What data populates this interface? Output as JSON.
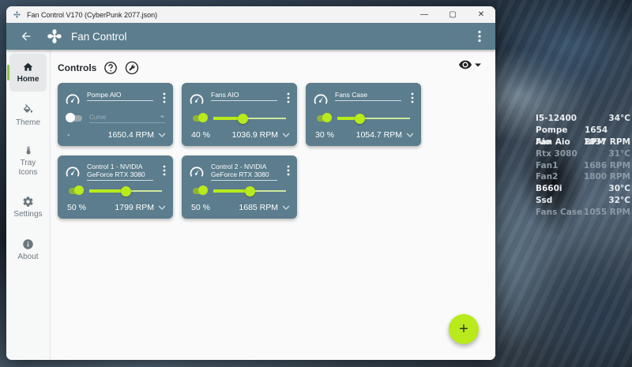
{
  "window": {
    "title": "Fan Control V170 (CyberPunk 2077.json)",
    "min_glyph": "—",
    "max_glyph": "▢",
    "close_glyph": "✕"
  },
  "appbar": {
    "title": "Fan Control"
  },
  "nav": [
    {
      "id": "home",
      "label": "Home",
      "icon": "home-icon",
      "active": true
    },
    {
      "id": "theme",
      "label": "Theme",
      "icon": "paint-bucket-icon",
      "active": false
    },
    {
      "id": "tray",
      "label": "Tray Icons",
      "icon": "thermometer-icon",
      "active": false
    },
    {
      "id": "settings",
      "label": "Settings",
      "icon": "gear-icon",
      "active": false
    },
    {
      "id": "about",
      "label": "About",
      "icon": "info-icon",
      "active": false
    }
  ],
  "controls": {
    "title": "Controls",
    "cards": [
      {
        "name": "Pompe AIO",
        "enabled": false,
        "mode": "select",
        "curve_placeholder": "Curve",
        "percent": "-",
        "rpm": "1650.4 RPM"
      },
      {
        "name": "Fans AIO",
        "enabled": true,
        "mode": "slider",
        "level": 0.4,
        "percent": "40 %",
        "rpm": "1036.9 RPM"
      },
      {
        "name": "Fans Case",
        "enabled": true,
        "mode": "slider",
        "level": 0.3,
        "percent": "30 %",
        "rpm": "1054.7 RPM"
      },
      {
        "name": "Control 1 - NVIDIA GeForce RTX 3080",
        "enabled": true,
        "mode": "slider",
        "level": 0.5,
        "percent": "50 %",
        "rpm": "1799 RPM"
      },
      {
        "name": "Control 2 - NVIDIA GeForce RTX 3080",
        "enabled": true,
        "mode": "slider",
        "level": 0.5,
        "percent": "50 %",
        "rpm": "1685 RPM"
      }
    ]
  },
  "fab": {
    "label": "+"
  },
  "desktop_sensors": [
    {
      "label": "I5-12400",
      "value": "34°C",
      "dim": false
    },
    {
      "label": "Pompe Aio",
      "value": "1654 RPM",
      "dim": false
    },
    {
      "label": "Fan Aio",
      "value": "1037 RPM",
      "dim": false
    },
    {
      "label": "Rtx 3080",
      "value": "31°C",
      "dim": true
    },
    {
      "label": "Fan1",
      "value": "1686 RPM",
      "dim": true
    },
    {
      "label": "Fan2",
      "value": "1800 RPM",
      "dim": true
    },
    {
      "label": "B660i",
      "value": "30°C",
      "dim": false
    },
    {
      "label": "Ssd",
      "value": "32°C",
      "dim": false
    },
    {
      "label": "Fans Case",
      "value": "1055 RPM",
      "dim": true
    }
  ],
  "colors": {
    "accent": "#b8ea1c",
    "card": "#5b7d8d",
    "appbar": "#5b7d8d"
  }
}
